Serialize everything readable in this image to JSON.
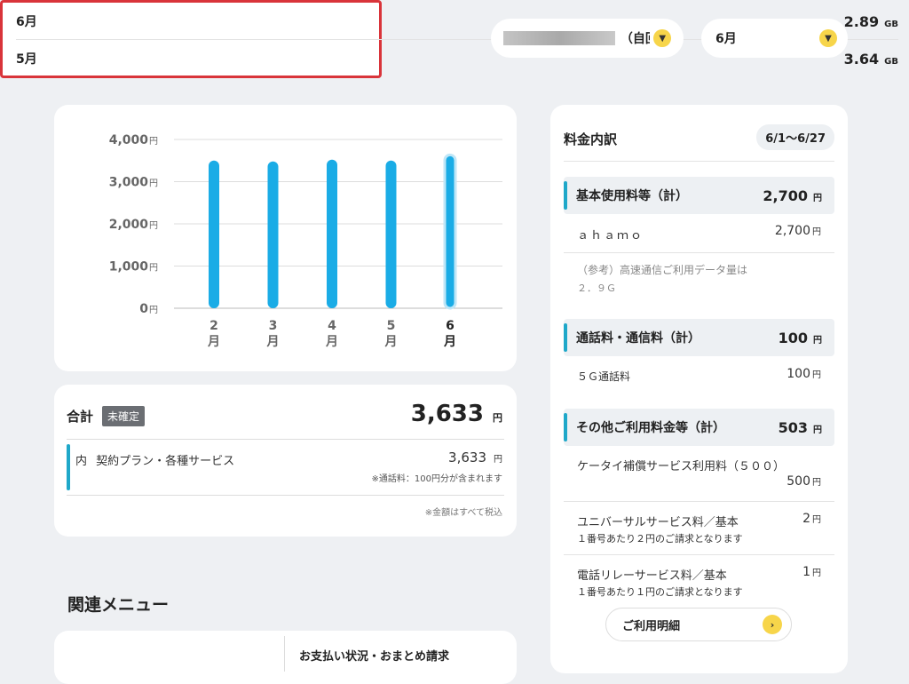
{
  "usage": [
    {
      "month": "6月",
      "value": "2.89",
      "unit": "GB"
    },
    {
      "month": "5月",
      "value": "3.64",
      "unit": "GB"
    }
  ],
  "selectors": {
    "line_suffix": "（自回",
    "month": "6月"
  },
  "chart_data": {
    "type": "bar",
    "categories": [
      "2月",
      "3月",
      "4月",
      "5月",
      "6月"
    ],
    "values": [
      3500,
      3480,
      3520,
      3500,
      3633
    ],
    "ylim": [
      0,
      4000
    ],
    "yticks": [
      "4,000",
      "3,000",
      "2,000",
      "1,000",
      "0"
    ],
    "ytick_unit": "円",
    "grid": true,
    "bar_color": "#1aace6",
    "highlight_category": "6月"
  },
  "total": {
    "label": "合計",
    "status_tag": "未確定",
    "amount": "3,633",
    "unit": "円",
    "item_prefix": "内",
    "item_label": "契約プラン・各種サービス",
    "item_amount": "3,633",
    "item_note": "※通話料：100円分が含まれます",
    "tax_note": "※金額はすべて税込"
  },
  "breakdown": {
    "title": "料金内訳",
    "period": "6/1〜6/27",
    "sections": [
      {
        "label": "基本使用料等（計）",
        "amount": "2,700",
        "unit": "円"
      },
      {
        "label": "通話料・通信料（計）",
        "amount": "100",
        "unit": "円"
      },
      {
        "label": "その他ご利用料金等（計）",
        "amount": "503",
        "unit": "円"
      }
    ],
    "ahamo_label": "ａｈａｍｏ",
    "ahamo_amount": "2,700",
    "ref_note_1": "（参考）高速通信ご利用データ量は",
    "ref_note_2": "２．９Ｇ",
    "call_label": "５Ｇ通話料",
    "call_amount": "100",
    "insurance_label": "ケータイ補償サービス利用料（５００）",
    "insurance_amount": "500",
    "universal_label": "ユニバーサルサービス料／基本",
    "universal_amount": "2",
    "universal_note": "１番号あたり２円のご請求となります",
    "relay_label": "電話リレーサービス料／基本",
    "relay_amount": "1",
    "relay_note": "１番号あたり１円のご請求となります",
    "yen": "円",
    "detail_button": "ご利用明細"
  },
  "related": {
    "heading": "関連メニュー",
    "partial_item": "お支払い状況・おまとめ請求"
  },
  "colors": {
    "accent": "#f7d54a",
    "highlight_border": "#d9343a",
    "section_bar": "#1fa8c9"
  }
}
